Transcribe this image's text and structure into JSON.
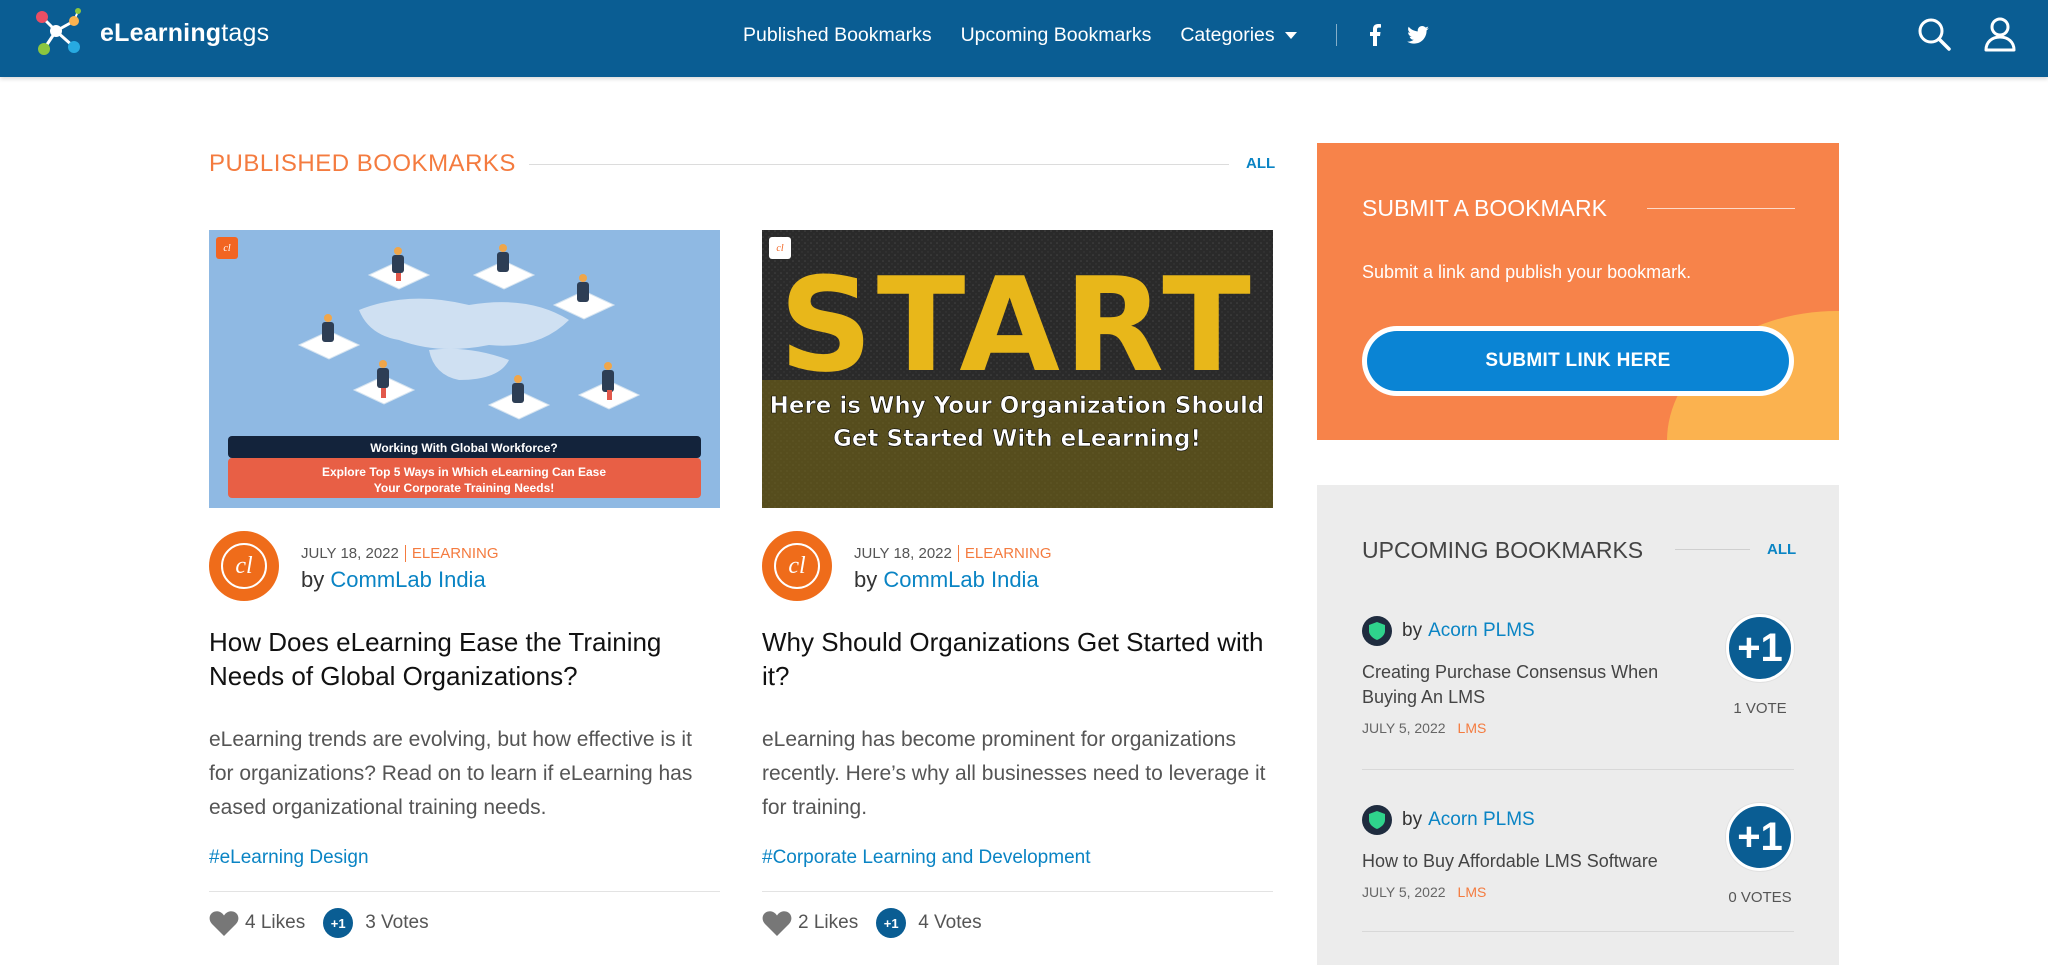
{
  "header": {
    "logo_bold": "eLearning",
    "logo_light": "tags",
    "nav": [
      "Published Bookmarks",
      "Upcoming Bookmarks",
      "Categories"
    ],
    "social": [
      "facebook-icon",
      "twitter-icon"
    ],
    "icons": [
      "search-icon",
      "user-icon"
    ],
    "bg_color": "#0a5d93"
  },
  "published": {
    "title": "PUBLISHED  BOOKMARKS",
    "all_label": "ALL",
    "cards": [
      {
        "image_caption_top": "Working With Global Workforce?",
        "image_caption_line1": "Explore Top 5 Ways in Which eLearning Can Ease",
        "image_caption_line2": "Your Corporate Training Needs!",
        "date": "JULY 18, 2022",
        "category": "ELEARNING",
        "by_label": "by",
        "author": "CommLab India",
        "title": "How  Does eLearning  Ease the Training Needs of Global Organizations?",
        "description": "eLearning trends are evolving, but how effective is it for organizations? Read on to learn if eLearning has eased organizational training needs.",
        "tag": "#eLearning Design",
        "likes": "4 Likes",
        "votes": "3 Votes",
        "plus": "+1"
      },
      {
        "image_big": "START",
        "image_caption_line1": "Here is Why Your Organization Should",
        "image_caption_line2": "Get Started With eLearning!",
        "date": "JULY 18, 2022",
        "category": "ELEARNING",
        "by_label": "by",
        "author": "CommLab India",
        "title": "Why Should Organizations Get Started with it?",
        "description": "eLearning has become prominent for organizations recently. Here’s why all businesses need to leverage it for training.",
        "tag": "#Corporate Learning and Development",
        "likes": "2 Likes",
        "votes": "4 Votes",
        "plus": "+1"
      }
    ]
  },
  "submit": {
    "title": "SUBMIT A BOOKMARK",
    "subtitle": "Submit a link and publish your bookmark.",
    "button": "SUBMIT LINK HERE",
    "bg_color": "#f7834a"
  },
  "upcoming": {
    "title": "UPCOMING BOOKMARKS",
    "all_label": "ALL",
    "items": [
      {
        "by_label": "by",
        "author": "Acorn PLMS",
        "text": "Creating  Purchase Consensus When Buying An  LMS",
        "date": "JULY 5, 2022",
        "category": "LMS",
        "plus": "+1",
        "votes": "1 VOTE"
      },
      {
        "by_label": "by",
        "author": "Acorn PLMS",
        "text": "How to  Buy Affordable  LMS Software",
        "date": "JULY 5, 2022",
        "category": "LMS",
        "plus": "+1",
        "votes": "0 VOTES"
      }
    ]
  }
}
